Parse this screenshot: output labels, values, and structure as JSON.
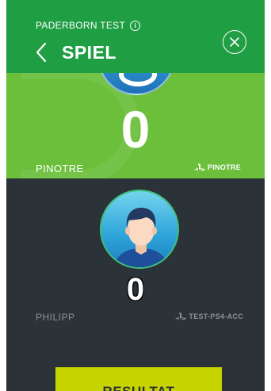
{
  "header": {
    "subtitle": "PADERBORN TEST",
    "info_badge": "i",
    "title": "SPIEL",
    "back_icon": "chevron-left-icon",
    "close_icon": "close-circle-icon"
  },
  "player1": {
    "score": "0",
    "name": "PINOTRE",
    "psn_id": "PINOTRE",
    "platform_icon": "playstation-icon"
  },
  "player2": {
    "score": "0",
    "name": "PHILIPP",
    "psn_id": "TEST-PS4-ACC",
    "platform_icon": "playstation-icon"
  },
  "result_button": "RESULTAT",
  "colors": {
    "header_green": "#1f9e43",
    "player1_green": "#6bbf3b",
    "dark_bg": "#2b3238",
    "result_yellow": "#c7d400"
  }
}
